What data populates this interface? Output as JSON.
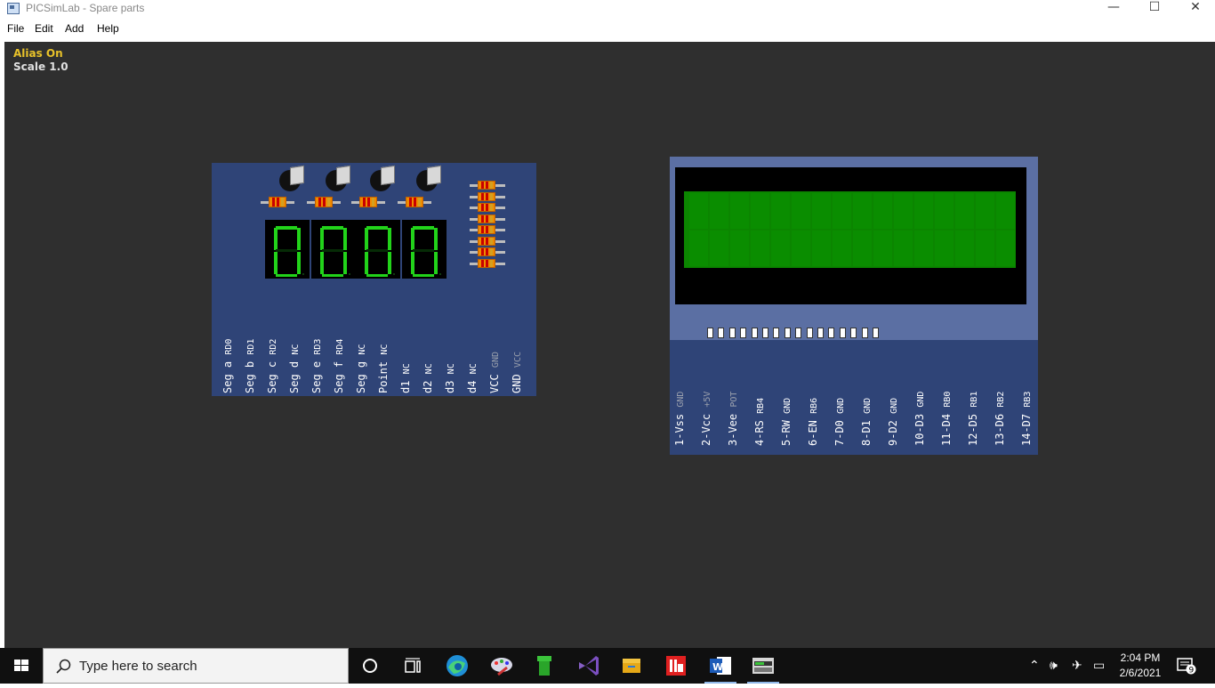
{
  "window": {
    "title": "PICSimLab - Spare parts",
    "min_glyph": "—",
    "max_glyph": "☐",
    "close_glyph": "✕"
  },
  "menubar": {
    "items": [
      "File",
      "Edit",
      "Add",
      "Help"
    ]
  },
  "workspace": {
    "alias_status": "Alias On",
    "scale": "Scale 1.0"
  },
  "seg_board": {
    "pins": [
      {
        "pin": "Seg a",
        "conn": "RD0"
      },
      {
        "pin": "Seg b",
        "conn": "RD1"
      },
      {
        "pin": "Seg c",
        "conn": "RD2"
      },
      {
        "pin": "Seg d",
        "conn": "NC"
      },
      {
        "pin": "Seg e",
        "conn": "RD3"
      },
      {
        "pin": "Seg f",
        "conn": "RD4"
      },
      {
        "pin": "Seg g",
        "conn": "NC"
      },
      {
        "pin": "Point",
        "conn": "NC"
      },
      {
        "pin": "d1",
        "conn": "NC"
      },
      {
        "pin": "d2",
        "conn": "NC"
      },
      {
        "pin": "d3",
        "conn": "NC"
      },
      {
        "pin": "d4",
        "conn": "NC"
      },
      {
        "pin": "VCC",
        "conn": "GND"
      },
      {
        "pin": "GND",
        "conn": "VCC"
      }
    ],
    "digit_color": "#22d31a"
  },
  "lcd_board": {
    "pins": [
      {
        "pin": "1-Vss",
        "conn": "GND"
      },
      {
        "pin": "2-Vcc",
        "conn": "+5V"
      },
      {
        "pin": "3-Vee",
        "conn": "POT"
      },
      {
        "pin": "4-RS",
        "conn": "RB4"
      },
      {
        "pin": "5-RW",
        "conn": "GND"
      },
      {
        "pin": "6-EN",
        "conn": "RB6"
      },
      {
        "pin": "7-D0",
        "conn": "GND"
      },
      {
        "pin": "8-D1",
        "conn": "GND"
      },
      {
        "pin": "9-D2",
        "conn": "GND"
      },
      {
        "pin": "10-D3",
        "conn": "GND"
      },
      {
        "pin": "11-D4",
        "conn": "RB0"
      },
      {
        "pin": "12-D5",
        "conn": "RB1"
      },
      {
        "pin": "13-D6",
        "conn": "RB2"
      },
      {
        "pin": "14-D7",
        "conn": "RB3"
      }
    ],
    "screen_color": "#0b8500"
  },
  "taskbar": {
    "search_placeholder": "Type here to search",
    "time": "2:04 PM",
    "date": "2/6/2021",
    "notification_count": "9",
    "apps": [
      "task-view-icon",
      "edge-icon",
      "paint-icon",
      "green-pipe-icon",
      "visual-studio-icon",
      "file-explorer-icon",
      "picsimlab-red-icon",
      "word-icon",
      "picsimlab-icon"
    ]
  }
}
